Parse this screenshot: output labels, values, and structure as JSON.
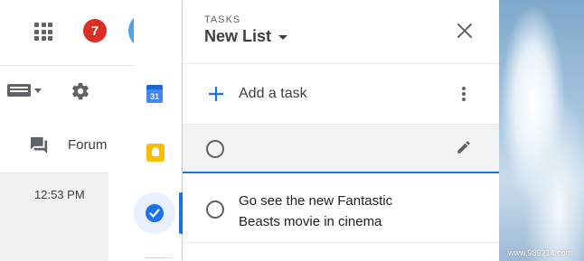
{
  "gmail": {
    "notification_count": "7",
    "forum_label": "Forum",
    "mail_time": "12:53 PM"
  },
  "side_panel": {
    "calendar_day": "31"
  },
  "tasks_panel": {
    "eyebrow": "TASKS",
    "list_title": "New List",
    "add_task_label": "Add a task",
    "new_task_value": "",
    "tasks": [
      {
        "title": "Go see the new Fantastic Beasts movie in cinema",
        "completed": false
      }
    ]
  },
  "watermark": "www.989214.com",
  "colors": {
    "accent": "#1a73e8",
    "badge": "#d93025",
    "keep": "#fbbc04",
    "calendar": "#4285f4"
  }
}
